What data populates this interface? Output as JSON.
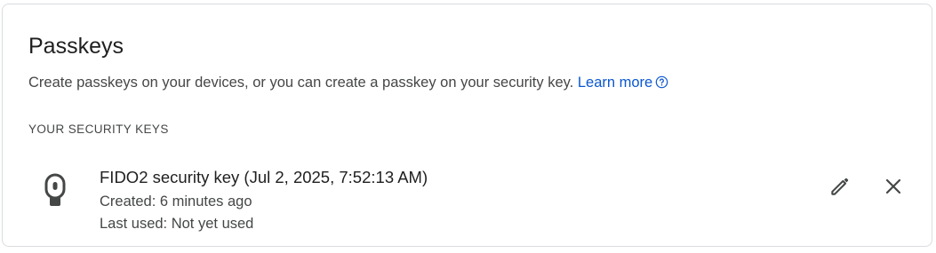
{
  "passkeys": {
    "title": "Passkeys",
    "description": "Create passkeys on your devices, or you can create a passkey on your security key.",
    "learn_more": "Learn more",
    "section_label": "YOUR SECURITY KEYS",
    "keys": [
      {
        "name": "FIDO2 security key (Jul 2, 2025, 7:52:13 AM)",
        "created": "Created: 6 minutes ago",
        "last_used": "Last used: Not yet used",
        "icon": "security-key-icon"
      }
    ]
  },
  "icons": {
    "help": "help-circle-icon",
    "edit": "pencil-icon",
    "remove": "close-icon"
  },
  "colors": {
    "link": "#0b57d0",
    "border": "#dadce0",
    "text_primary": "#1f1f1f",
    "text_secondary": "#444746"
  }
}
